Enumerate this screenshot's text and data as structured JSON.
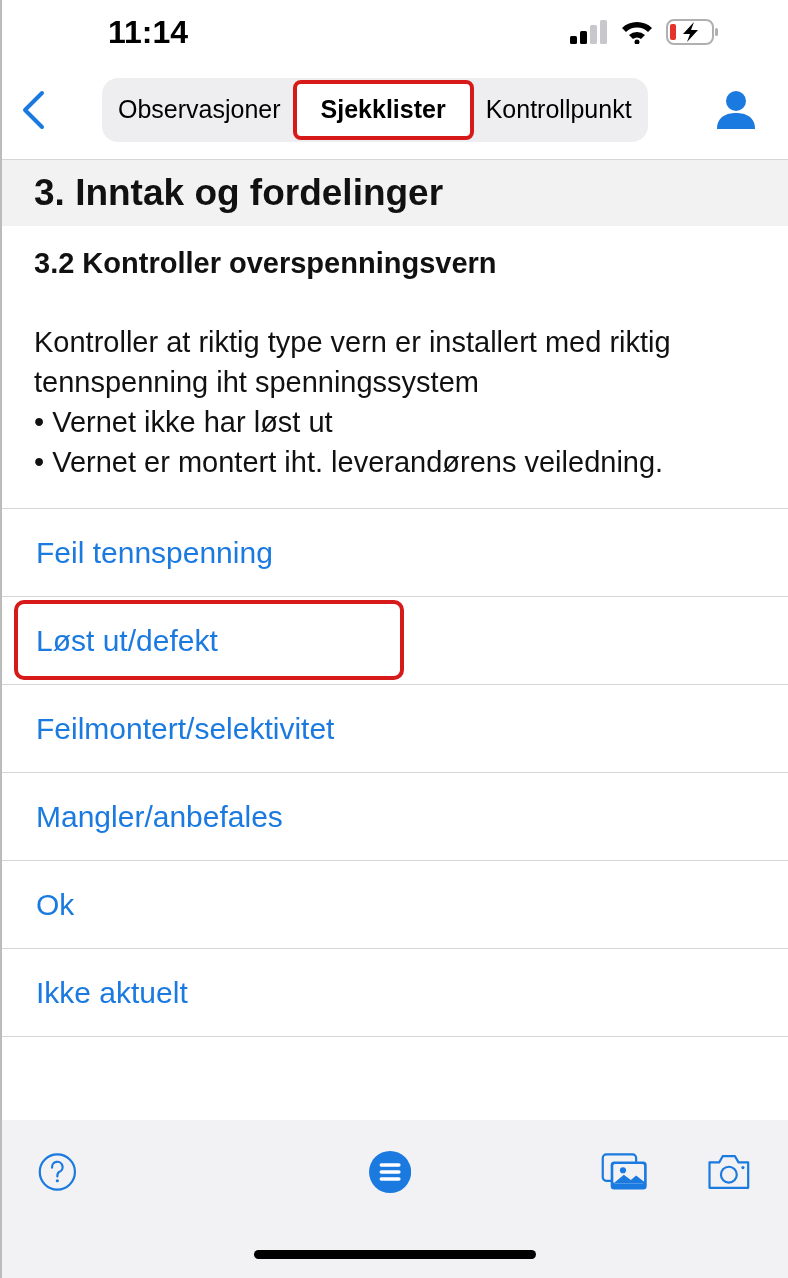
{
  "status_bar": {
    "time": "11:14"
  },
  "tabs": [
    {
      "label": "Observasjoner",
      "selected": false,
      "highlighted": false
    },
    {
      "label": "Sjekklister",
      "selected": true,
      "highlighted": true
    },
    {
      "label": "Kontrollpunkt",
      "selected": false,
      "highlighted": false
    }
  ],
  "section": {
    "title": "3. Inntak og fordelinger"
  },
  "checkpoint": {
    "title": "3.2 Kontroller overspenningsvern",
    "description": "Kontroller at riktig type vern er installert med riktig tennspenning iht spenningssystem\n• Vernet ikke har løst ut\n• Vernet er montert iht. leverandørens veiledning."
  },
  "options": [
    {
      "label": "Feil tennspenning",
      "highlighted": false
    },
    {
      "label": "Løst ut/defekt",
      "highlighted": true
    },
    {
      "label": "Feilmontert/selektivitet",
      "highlighted": false
    },
    {
      "label": "Mangler/anbefales",
      "highlighted": false
    },
    {
      "label": "Ok",
      "highlighted": false
    },
    {
      "label": "Ikke aktuelt",
      "highlighted": false
    }
  ]
}
